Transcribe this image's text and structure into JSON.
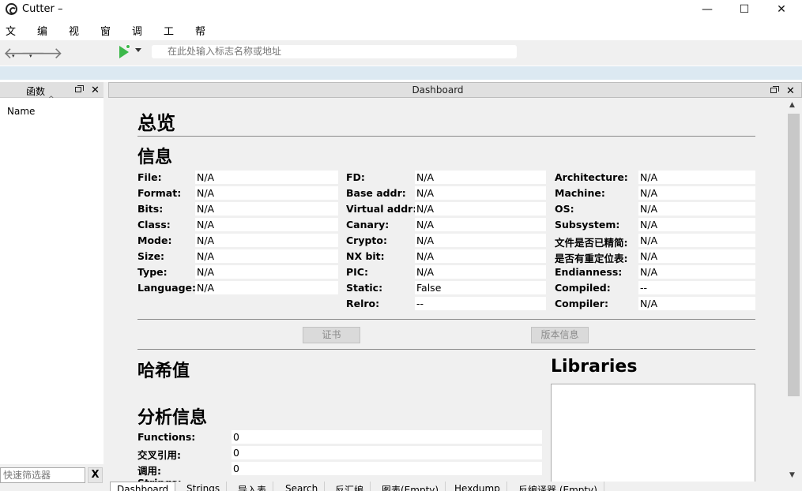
{
  "window": {
    "title": "Cutter –",
    "minimize": "—",
    "maximize": "☐",
    "close": "✕"
  },
  "menu": [
    "文件",
    "编辑",
    "视图",
    "窗口",
    "调试",
    "工具",
    "帮助"
  ],
  "toolbar": {
    "search_placeholder": "在此处输入标志名称或地址"
  },
  "functions_dock": {
    "title": "函数",
    "column": "Name",
    "filter_placeholder": "快速筛选器",
    "clear": "X"
  },
  "dashboard": {
    "title": "Dashboard",
    "overview": "总览",
    "info_heading": "信息",
    "col1": [
      {
        "label": "File:",
        "value": "N/A"
      },
      {
        "label": "Format:",
        "value": "N/A"
      },
      {
        "label": "Bits:",
        "value": "N/A"
      },
      {
        "label": "Class:",
        "value": "N/A"
      },
      {
        "label": "Mode:",
        "value": "N/A"
      },
      {
        "label": "Size:",
        "value": "N/A"
      },
      {
        "label": "Type:",
        "value": "N/A"
      },
      {
        "label": "Language:",
        "value": "N/A"
      }
    ],
    "col2": [
      {
        "label": "FD:",
        "value": "N/A"
      },
      {
        "label": "Base addr:",
        "value": "N/A"
      },
      {
        "label": "Virtual addr:",
        "value": "N/A"
      },
      {
        "label": "Canary:",
        "value": "N/A"
      },
      {
        "label": "Crypto:",
        "value": "N/A"
      },
      {
        "label": "NX bit:",
        "value": "N/A"
      },
      {
        "label": "PIC:",
        "value": "N/A"
      },
      {
        "label": "Static:",
        "value": "False"
      },
      {
        "label": "Relro:",
        "value": "--"
      }
    ],
    "col3": [
      {
        "label": "Architecture:",
        "value": "N/A"
      },
      {
        "label": "Machine:",
        "value": "N/A"
      },
      {
        "label": "OS:",
        "value": "N/A"
      },
      {
        "label": "Subsystem:",
        "value": "N/A"
      },
      {
        "label": "文件是否已精简:",
        "value": "N/A"
      },
      {
        "label": "是否有重定位表:",
        "value": "N/A"
      },
      {
        "label": "Endianness:",
        "value": "N/A"
      },
      {
        "label": "Compiled:",
        "value": "--"
      },
      {
        "label": "Compiler:",
        "value": "N/A"
      }
    ],
    "certificates_button": "证书",
    "version_button": "版本信息",
    "hashes_heading": "哈希值",
    "libraries_heading": "Libraries",
    "analysis_heading": "分析信息",
    "analysis": [
      {
        "label": "Functions:",
        "value": "0"
      },
      {
        "label": "交叉引用:",
        "value": "0"
      },
      {
        "label": "调用:",
        "value": "0"
      },
      {
        "label": "Strings:",
        "value": ""
      }
    ]
  },
  "tabs": [
    "Dashboard",
    "Strings",
    "导入表",
    "Search",
    "反汇编",
    "图表(Empty)",
    "Hexdump",
    "反编译器 (Empty)"
  ]
}
